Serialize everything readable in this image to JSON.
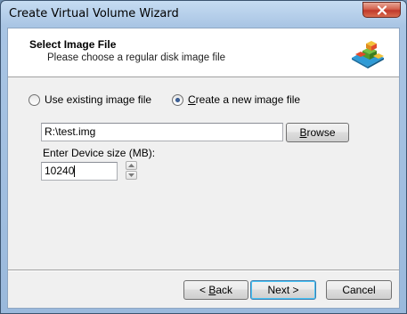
{
  "window": {
    "title": "Create Virtual Volume Wizard"
  },
  "header": {
    "title": "Select Image File",
    "subtitle": "Please choose a regular disk image file",
    "logo_icon": "cube-stack-icon"
  },
  "options": {
    "use_existing": {
      "label": "Use existing image file",
      "checked": false
    },
    "create_new": {
      "label_accel": "C",
      "label_rest": "reate a new image file",
      "checked": true
    }
  },
  "file": {
    "path": "R:\\test.img",
    "browse_accel": "B",
    "browse_rest": "rowse"
  },
  "device_size": {
    "label": "Enter Device size (MB):",
    "value": "10240"
  },
  "footer": {
    "back_prefix": "< ",
    "back_accel": "B",
    "back_rest": "ack",
    "next_label": "Next >",
    "cancel_label": "Cancel"
  },
  "colors": {
    "accent": "#48c3f4",
    "close": "#c0392b"
  }
}
